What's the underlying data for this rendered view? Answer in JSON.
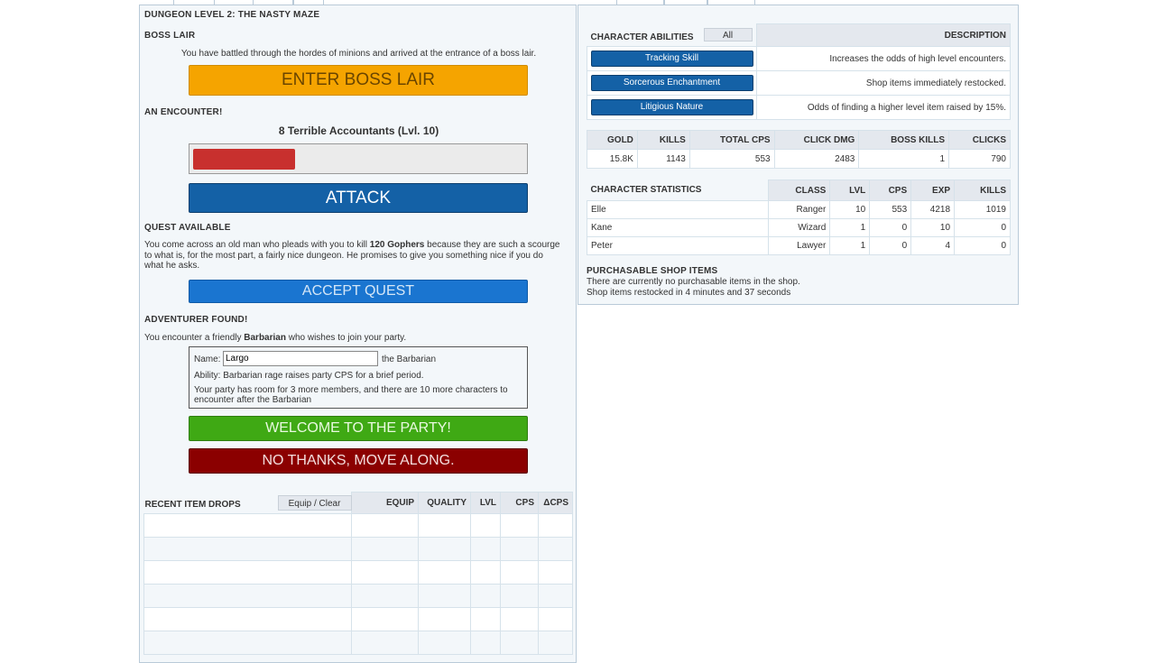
{
  "dungeon": {
    "title": "DUNGEON LEVEL 2: THE NASTY MAZE",
    "boss_section": "BOSS LAIR",
    "boss_text": "You have battled through the hordes of minions and arrived at the entrance of a boss lair.",
    "boss_button": "ENTER BOSS LAIR",
    "encounter_section": "AN ENCOUNTER!",
    "encounter_name": "8 Terrible Accountants (Lvl. 10)",
    "encounter_health_fraction": 0.31,
    "attack_button": "ATTACK",
    "quest_section": "QUEST AVAILABLE",
    "quest_text_1": "You come across an old man who pleads with you to kill ",
    "quest_target": "120 Gophers",
    "quest_text_2": " because they are such a scourge to what is, for the most part, a fairly nice dungeon. He promises to give you something nice if you do what he asks.",
    "quest_button": "ACCEPT QUEST",
    "adventurer_section": "ADVENTURER FOUND!",
    "adventurer_text_1": "You encounter a friendly ",
    "adventurer_class": "Barbarian",
    "adventurer_text_2": " who wishes to join your party.",
    "name_label": "Name:",
    "name_value": "Largo",
    "name_suffix": "the Barbarian",
    "ability_text": "Ability: Barbarian rage raises party CPS for a brief period.",
    "party_text": "Your party has room for 3 more members, and there are 10 more characters to encounter after the Barbarian",
    "welcome_button": "WELCOME TO THE PARTY!",
    "decline_button": "NO THANKS, MOVE ALONG."
  },
  "drops": {
    "title": "RECENT ITEM DROPS",
    "equip_clear": "Equip / Clear",
    "headers": [
      "EQUIP",
      "QUALITY",
      "LVL",
      "CPS",
      "ΔCPS"
    ],
    "row_count": 6
  },
  "abilities": {
    "title": "CHARACTER ABILITIES",
    "all_button": "All",
    "desc_header": "DESCRIPTION",
    "items": [
      {
        "name": "Tracking Skill",
        "desc": "Increases the odds of high level encounters."
      },
      {
        "name": "Sorcerous Enchantment",
        "desc": "Shop items immediately restocked."
      },
      {
        "name": "Litigious Nature",
        "desc": "Odds of finding a higher level item raised by 15%."
      }
    ]
  },
  "stats": {
    "headers": [
      "GOLD",
      "KILLS",
      "TOTAL CPS",
      "CLICK DMG",
      "BOSS KILLS",
      "CLICKS"
    ],
    "values": [
      "15.8K",
      "1143",
      "553",
      "2483",
      "1",
      "790"
    ]
  },
  "characters": {
    "title": "CHARACTER STATISTICS",
    "headers": [
      "CLASS",
      "LVL",
      "CPS",
      "EXP",
      "KILLS"
    ],
    "rows": [
      {
        "name": "Elle",
        "class": "Ranger",
        "lvl": "10",
        "cps": "553",
        "exp": "4218",
        "kills": "1019"
      },
      {
        "name": "Kane",
        "class": "Wizard",
        "lvl": "1",
        "cps": "0",
        "exp": "10",
        "kills": "0"
      },
      {
        "name": "Peter",
        "class": "Lawyer",
        "lvl": "1",
        "cps": "0",
        "exp": "4",
        "kills": "0"
      }
    ]
  },
  "shop": {
    "title": "PURCHASABLE SHOP ITEMS",
    "line1": "There are currently no purchasable items in the shop.",
    "line2": "Shop items restocked in 4 minutes and 37 seconds"
  },
  "colors": {
    "boss": "#f5a400",
    "attack": "#1461a6",
    "quest": "#1a75d0",
    "welcome": "#3fa914",
    "decline": "#8b0000",
    "health": "#c8302e"
  }
}
